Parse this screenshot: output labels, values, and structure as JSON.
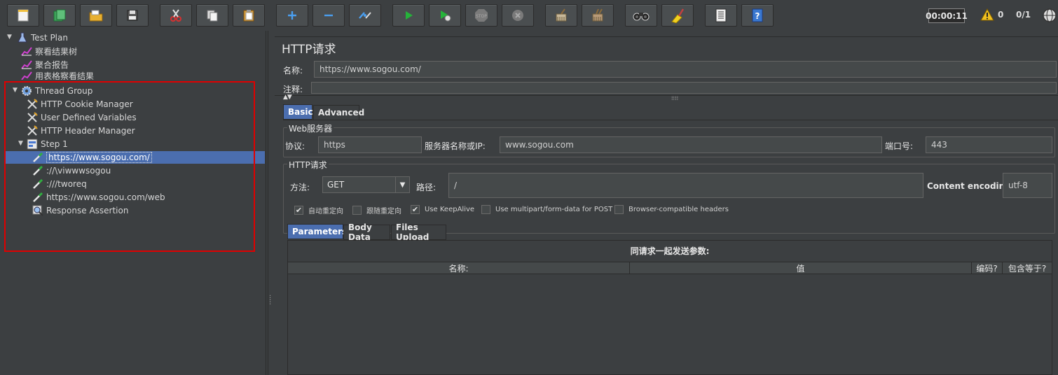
{
  "toolbar": {
    "buttons": [
      {
        "name": "new-button",
        "icon": "new-file-icon"
      },
      {
        "name": "templates-button",
        "icon": "templates-icon"
      },
      {
        "name": "open-button",
        "icon": "open-folder-icon"
      },
      {
        "name": "save-button",
        "icon": "save-icon"
      },
      {
        "name": "cut-button",
        "icon": "scissors-icon"
      },
      {
        "name": "copy-button",
        "icon": "copy-icon"
      },
      {
        "name": "paste-button",
        "icon": "paste-icon"
      },
      {
        "name": "expand-button",
        "icon": "plus-icon"
      },
      {
        "name": "collapse-button",
        "icon": "minus-icon"
      },
      {
        "name": "toggle-button",
        "icon": "toggle-icon"
      },
      {
        "name": "start-button",
        "icon": "play-icon"
      },
      {
        "name": "start-no-pause-button",
        "icon": "play-no-timers-icon"
      },
      {
        "name": "stop-button",
        "icon": "stop-icon"
      },
      {
        "name": "shutdown-button",
        "icon": "shutdown-icon"
      },
      {
        "name": "clear-button",
        "icon": "broom-icon"
      },
      {
        "name": "clear-all-button",
        "icon": "broom-all-icon"
      },
      {
        "name": "search-button",
        "icon": "binoculars-icon"
      },
      {
        "name": "reset-search-button",
        "icon": "reset-search-icon"
      },
      {
        "name": "function-helper-button",
        "icon": "list-icon"
      },
      {
        "name": "help-button",
        "icon": "help-icon"
      }
    ],
    "timer": "00:00:11",
    "error_count": "0",
    "threads": "0/1"
  },
  "tree": {
    "test_plan": "Test Plan",
    "listener_1": "察看结果树",
    "listener_2": "聚合报告",
    "listener_3": "用表格察看结果",
    "thread_group": "Thread Group",
    "cookie_manager": "HTTP Cookie Manager",
    "user_vars": "User Defined Variables",
    "header_manager": "HTTP Header Manager",
    "step": "Step 1",
    "sampler_1": "https://www.sogou.com/",
    "sampler_2": "://\\viwwwsogou",
    "sampler_3": ":///tworeq",
    "sampler_4": "https://www.sogou.com/web",
    "assertion": "Response Assertion"
  },
  "panel": {
    "title": "HTTP请求",
    "name_label": "名称:",
    "name_value": "https://www.sogou.com/",
    "comment_label": "注释:",
    "tabs": [
      "Basic",
      "Advanced"
    ],
    "web_server": {
      "legend": "Web服务器",
      "protocol_label": "协议:",
      "protocol_value": "https",
      "server_label": "服务器名称或IP:",
      "server_value": "www.sogou.com",
      "port_label": "端口号:",
      "port_value": "443"
    },
    "http_request": {
      "legend": "HTTP请求",
      "method_label": "方法:",
      "method_value": "GET",
      "path_label": "路径:",
      "path_value": "/",
      "encoding_label": "Content encoding:",
      "encoding_value": "utf-8"
    },
    "checkboxes": [
      {
        "label": "自动重定向",
        "checked": true
      },
      {
        "label": "跟随重定向",
        "checked": false
      },
      {
        "label": "Use KeepAlive",
        "checked": true
      },
      {
        "label": "Use multipart/form-data for POST",
        "checked": false
      },
      {
        "label": "Browser-compatible headers",
        "checked": false
      }
    ],
    "sub_tabs": [
      "Parameters",
      "Body Data",
      "Files Upload"
    ],
    "params": {
      "caption": "同请求一起发送参数:",
      "columns": [
        "名称:",
        "值",
        "编码?",
        "包含等于?"
      ]
    }
  },
  "colors": {
    "background": "#3c3f41",
    "selection": "#4b6eaf",
    "highlight_box": "#e00000"
  }
}
